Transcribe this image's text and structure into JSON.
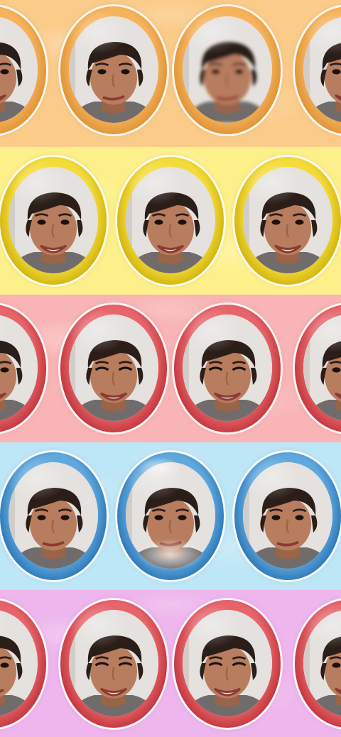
{
  "bands": [
    {
      "name": "orange",
      "color": "#fbcb8a",
      "rim_outer": "#d98a2b",
      "rim_inner": "#f6b35c",
      "bubbles": [
        {
          "face": "smile"
        },
        {
          "face": "smirk"
        },
        {
          "face": "blur"
        },
        {
          "face": "smile"
        }
      ]
    },
    {
      "name": "yellow",
      "color": "#fdf08a",
      "rim_outer": "#c9a800",
      "rim_inner": "#f3dc3a",
      "bubbles": [
        {
          "face": "grin"
        },
        {
          "face": "grin"
        },
        {
          "face": "grin"
        }
      ]
    },
    {
      "name": "pink",
      "color": "#f9b5b5",
      "rim_outer": "#b8282e",
      "rim_inner": "#e6656b",
      "bubbles": [
        {
          "face": "grin"
        },
        {
          "face": "wink"
        },
        {
          "face": "wink"
        },
        {
          "face": "grin"
        }
      ]
    },
    {
      "name": "blue",
      "color": "#bde6f6",
      "rim_outer": "#1f6ab0",
      "rim_inner": "#5fa8dc",
      "bubbles": [
        {
          "face": "smirk"
        },
        {
          "face": "cloud"
        },
        {
          "face": "smirk"
        }
      ]
    },
    {
      "name": "lavender",
      "color": "#eeb6ec",
      "rim_outer": "#b8282e",
      "rim_inner": "#e6656b",
      "bubbles": [
        {
          "face": "smirk"
        },
        {
          "face": "wink"
        },
        {
          "face": "wink"
        },
        {
          "face": "smile"
        }
      ]
    }
  ],
  "colors": {
    "hair": "#2b1d18",
    "skin": "#b87c5e",
    "skin_shade": "#9a6448",
    "shirt": "#6f6c6b",
    "lips": "#8a3b33",
    "teeth": "#f4f0ea"
  }
}
